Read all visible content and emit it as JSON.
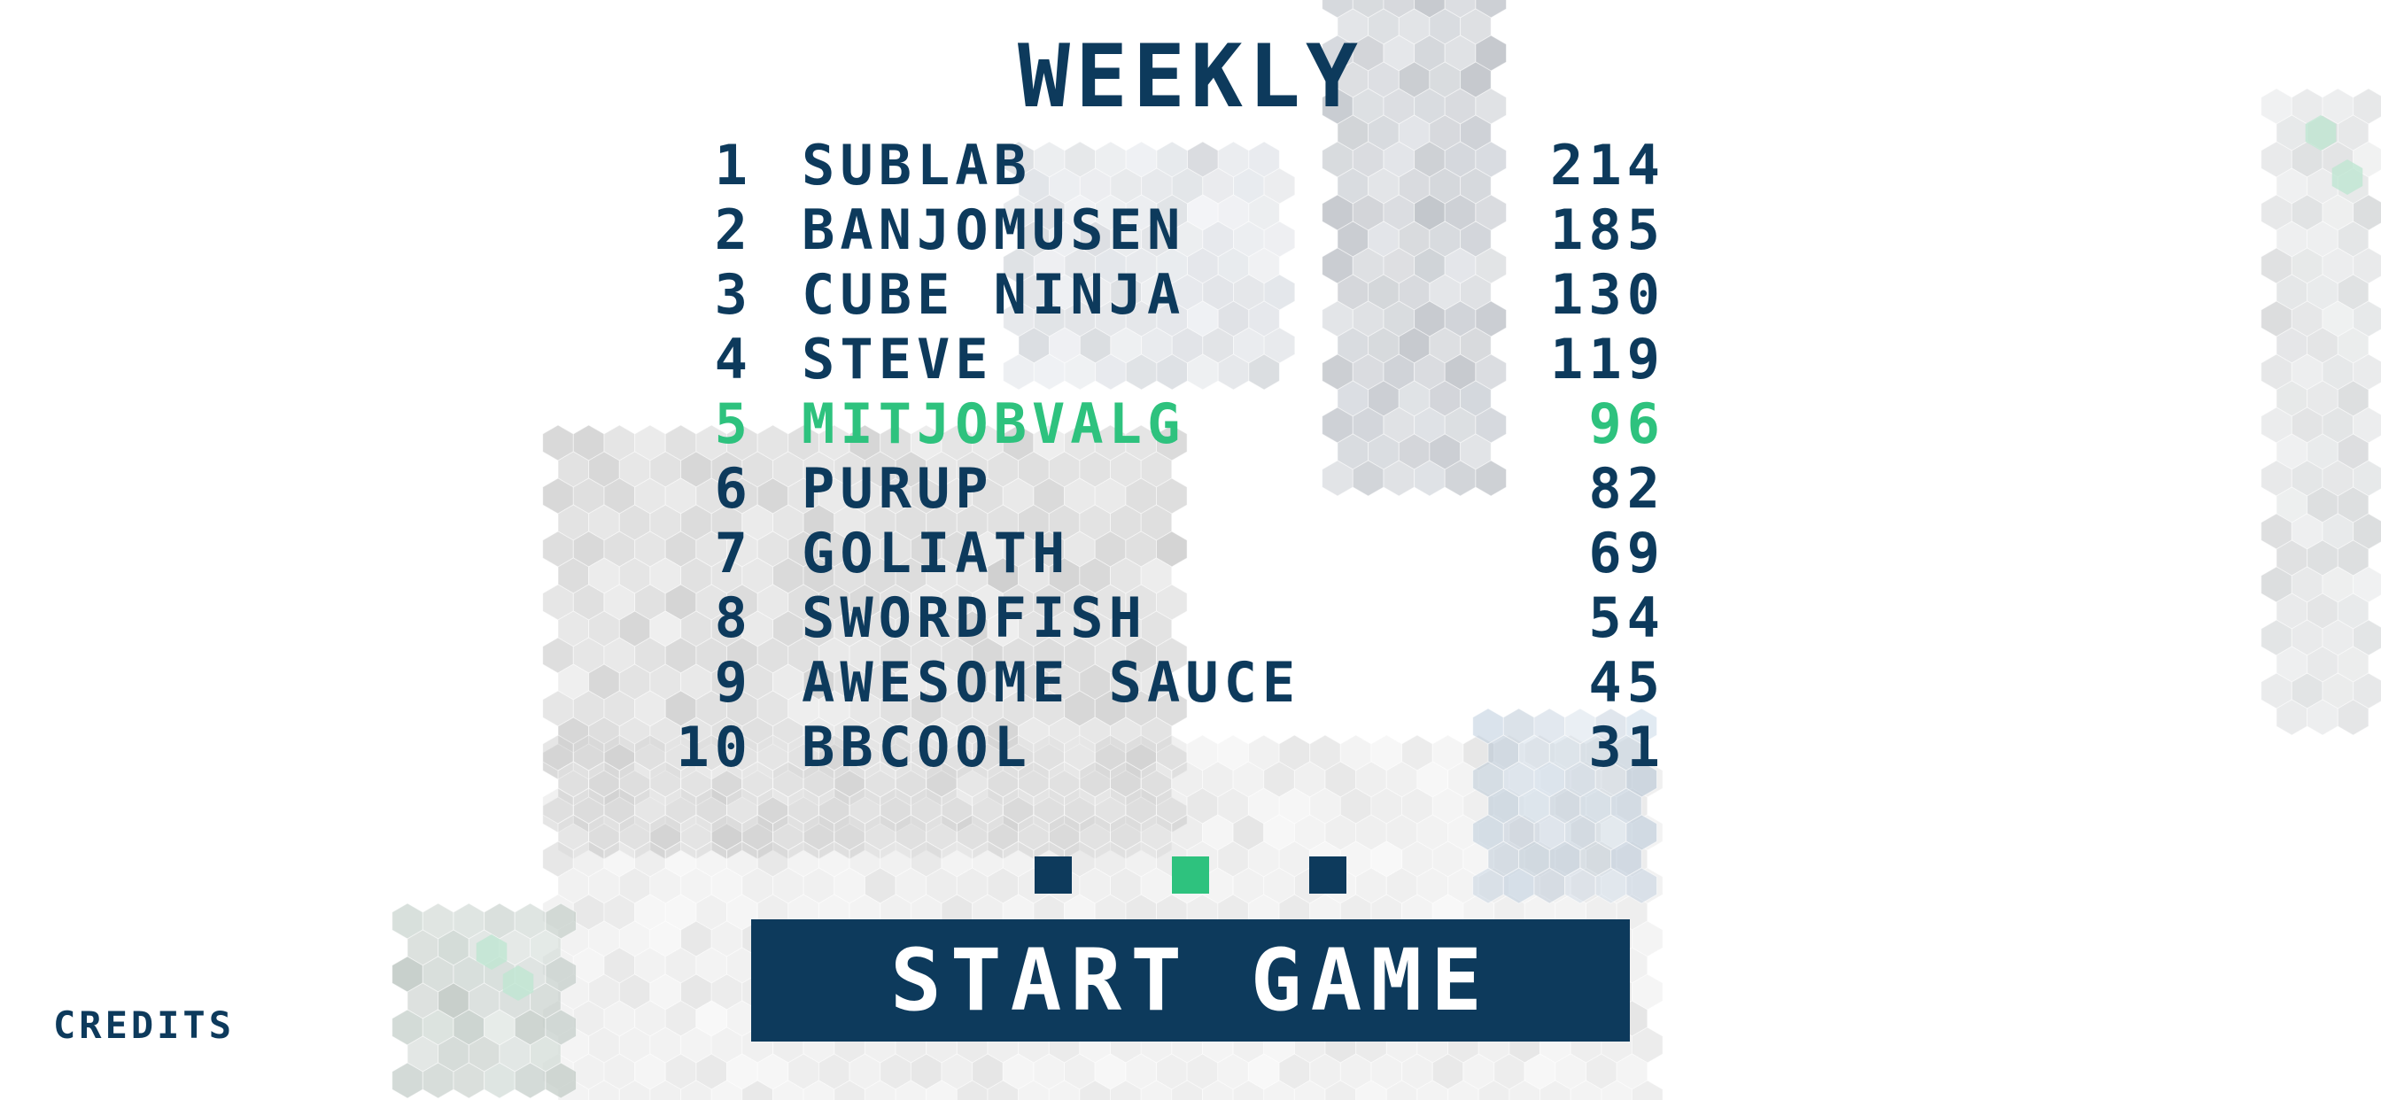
{
  "leaderboard": {
    "title": "WEEKLY",
    "entries": [
      {
        "rank": "1",
        "name": "SUBLAB",
        "score": "214"
      },
      {
        "rank": "2",
        "name": "BANJOMUSEN",
        "score": "185"
      },
      {
        "rank": "3",
        "name": "CUBE NINJA",
        "score": "130"
      },
      {
        "rank": "4",
        "name": "STEVE",
        "score": "119"
      },
      {
        "rank": "5",
        "name": "MITJOBVALG",
        "score": "96"
      },
      {
        "rank": "6",
        "name": "PURUP",
        "score": "82"
      },
      {
        "rank": "7",
        "name": "GOLIATH",
        "score": "69"
      },
      {
        "rank": "8",
        "name": "SWORDFISH",
        "score": "54"
      },
      {
        "rank": "9",
        "name": "AWESOME SAUCE",
        "score": "45"
      },
      {
        "rank": "10",
        "name": "BBCOOL",
        "score": "31"
      }
    ],
    "highlighted_rank": "5"
  },
  "pager": {
    "count": 3,
    "active_index": 1
  },
  "start_button": {
    "label": "START GAME"
  },
  "credits": {
    "label": "CREDITS"
  },
  "colors": {
    "primary": "#0d3a5c",
    "accent": "#2ec27e",
    "background": "#ffffff"
  }
}
